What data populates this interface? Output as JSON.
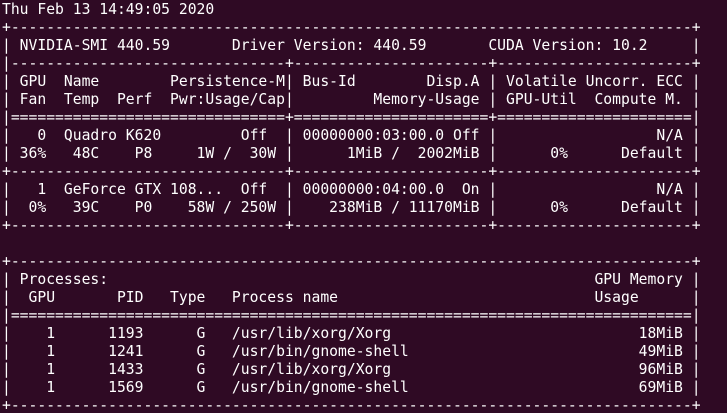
{
  "terminal": {
    "lines": [
      "Thu Feb 13 14:49:05 2020",
      "+-----------------------------------------------------------------------------+",
      "| NVIDIA-SMI 440.59       Driver Version: 440.59       CUDA Version: 10.2     |",
      "|-------------------------------+----------------------+----------------------+",
      "| GPU  Name        Persistence-M| Bus-Id        Disp.A | Volatile Uncorr. ECC |",
      "| Fan  Temp  Perf  Pwr:Usage/Cap|         Memory-Usage | GPU-Util  Compute M. |",
      "|===============================+======================+======================|",
      "|   0  Quadro K620         Off  | 00000000:03:00.0 Off |                  N/A |",
      "| 36%   48C    P8     1W /  30W |      1MiB /  2002MiB |      0%      Default |",
      "+-------------------------------+----------------------+----------------------+",
      "|   1  GeForce GTX 108...  Off  | 00000000:04:00.0  On |                  N/A |",
      "|  0%   39C    P0    58W / 250W |    238MiB / 11170MiB |      0%      Default |",
      "+-------------------------------+----------------------+----------------------+",
      "",
      "+-----------------------------------------------------------------------------+",
      "| Processes:                                                       GPU Memory |",
      "|  GPU       PID   Type   Process name                             Usage      |",
      "|=============================================================================|",
      "|    1      1193      G   /usr/lib/xorg/Xorg                            18MiB |",
      "|    1      1241      G   /usr/bin/gnome-shell                          49MiB |",
      "|    1      1433      G   /usr/lib/xorg/Xorg                            96MiB |",
      "|    1      1569      G   /usr/bin/gnome-shell                          69MiB |",
      "+-----------------------------------------------------------------------------+"
    ]
  },
  "colors": {
    "background": "#2f0a24",
    "foreground": "#ffffff"
  }
}
